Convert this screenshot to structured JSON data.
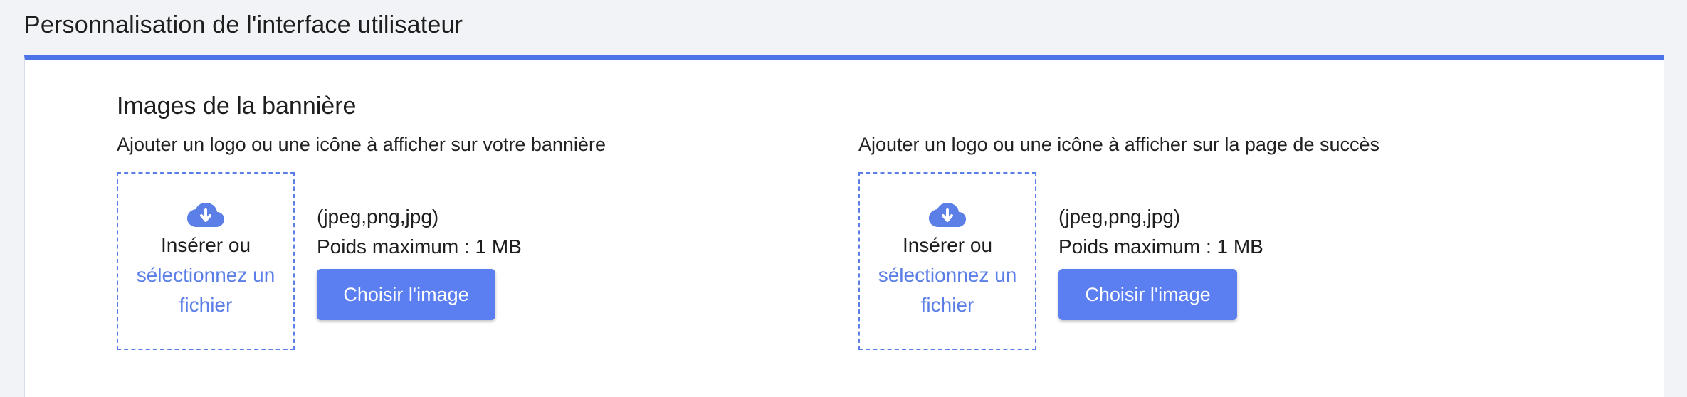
{
  "page": {
    "title": "Personnalisation de l'interface utilisateur"
  },
  "section": {
    "title": "Images de la bannière"
  },
  "uploaders": [
    {
      "description": "Ajouter un logo ou une icône à afficher sur votre bannière",
      "dropzone_text": "Insérer ou",
      "dropzone_link": "sélectionnez un fichier",
      "formats": "(jpeg,png,jpg)",
      "max_size": "Poids maximum : 1 MB",
      "button_label": "Choisir l'image",
      "icon": "cloud-download-icon"
    },
    {
      "description": "Ajouter un logo ou une icône à afficher sur la page de succès",
      "dropzone_text": "Insérer ou",
      "dropzone_link": "sélectionnez un fichier",
      "formats": "(jpeg,png,jpg)",
      "max_size": "Poids maximum : 1 MB",
      "button_label": "Choisir l'image",
      "icon": "cloud-download-icon"
    }
  ],
  "colors": {
    "accent": "#4c74e8",
    "button": "#5b7ff0",
    "link": "#5b7fe6",
    "background": "#f2f3f7"
  }
}
